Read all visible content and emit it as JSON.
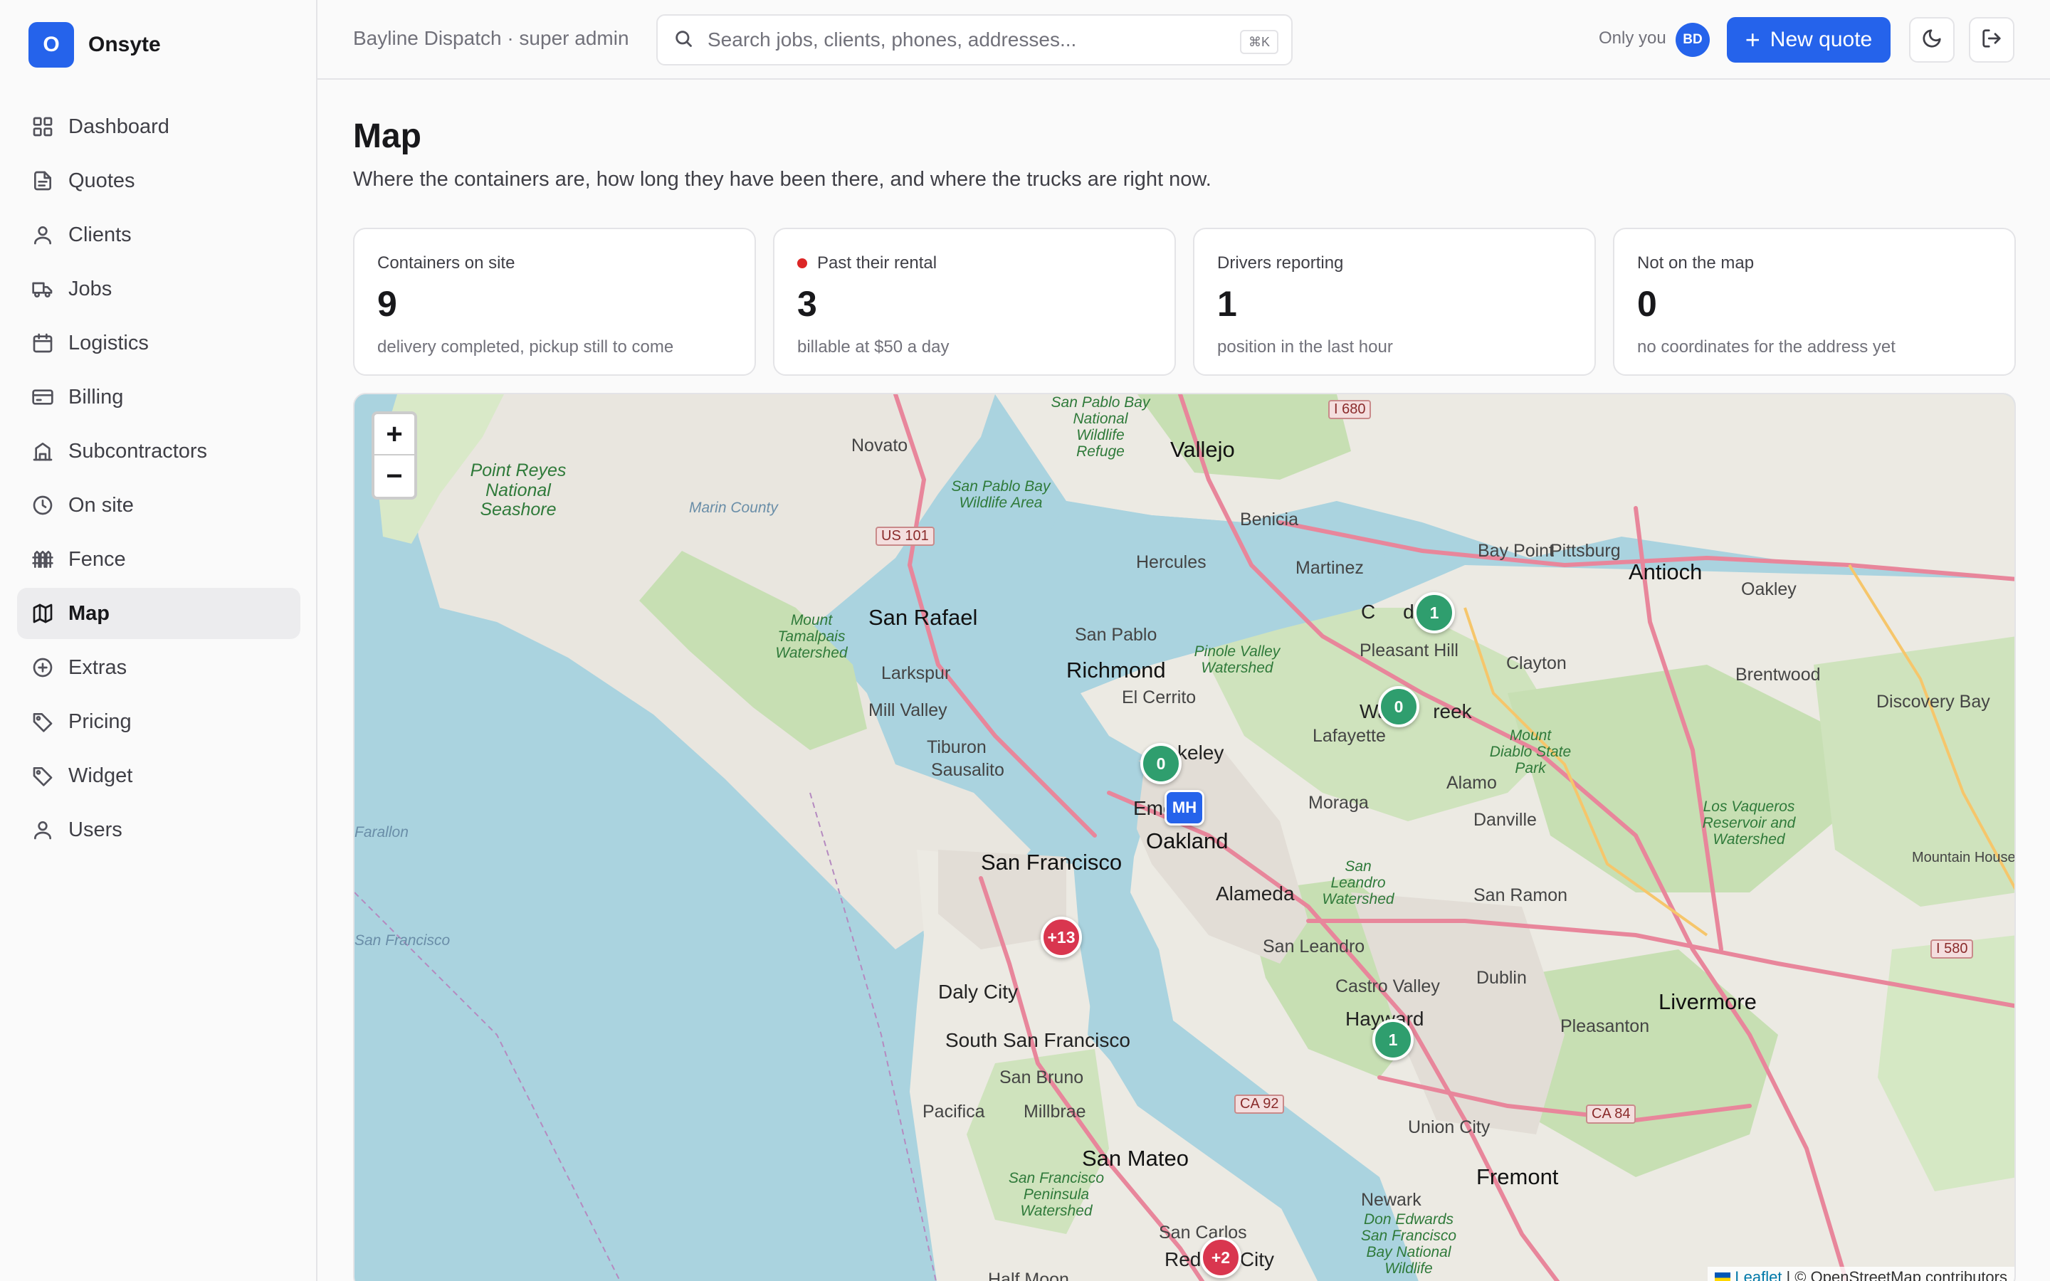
{
  "brand": {
    "logo_letter": "O",
    "name": "Onsyte"
  },
  "nav": {
    "items": [
      {
        "label": "Dashboard",
        "icon": "dashboard-icon"
      },
      {
        "label": "Quotes",
        "icon": "document-icon"
      },
      {
        "label": "Clients",
        "icon": "user-icon"
      },
      {
        "label": "Jobs",
        "icon": "truck-icon"
      },
      {
        "label": "Logistics",
        "icon": "calendar-icon"
      },
      {
        "label": "Billing",
        "icon": "credit-card-icon"
      },
      {
        "label": "Subcontractors",
        "icon": "building-icon"
      },
      {
        "label": "On site",
        "icon": "clock-icon"
      },
      {
        "label": "Fence",
        "icon": "fence-icon"
      },
      {
        "label": "Map",
        "icon": "map-icon",
        "active": true
      },
      {
        "label": "Extras",
        "icon": "plus-circle-icon"
      },
      {
        "label": "Pricing",
        "icon": "tag-icon"
      },
      {
        "label": "Widget",
        "icon": "tag-icon"
      },
      {
        "label": "Users",
        "icon": "user-icon"
      }
    ]
  },
  "header": {
    "org": "Bayline Dispatch · super admin",
    "search_placeholder": "Search jobs, clients, phones, addresses...",
    "search_shortcut": "⌘K",
    "visibility": "Only you",
    "avatar_initials": "BD",
    "new_quote_label": "New quote"
  },
  "page": {
    "title": "Map",
    "subtitle": "Where the containers are, how long they have been there, and where the trucks are right now."
  },
  "stats": [
    {
      "label": "Containers on site",
      "value": "9",
      "note": "delivery completed, pickup still to come",
      "dot": false
    },
    {
      "label": "Past their rental",
      "value": "3",
      "note": "billable at $50 a day",
      "dot": true,
      "dot_color": "#dc2626"
    },
    {
      "label": "Drivers reporting",
      "value": "1",
      "note": "position in the last hour",
      "dot": false
    },
    {
      "label": "Not on the map",
      "value": "0",
      "note": "no coordinates for the address yet",
      "dot": false
    }
  ],
  "map": {
    "zoom_in": "+",
    "zoom_out": "−",
    "markers": [
      {
        "label": "1",
        "color": "green"
      },
      {
        "label": "0",
        "color": "green"
      },
      {
        "label": "0",
        "color": "green"
      },
      {
        "label": "+13",
        "color": "red"
      },
      {
        "label": "1",
        "color": "green"
      },
      {
        "label": "+2",
        "color": "red"
      }
    ],
    "truck": {
      "label": "MH",
      "color": "#2563eb"
    },
    "attribution_leaflet": "Leaflet",
    "attribution_osm": "| © OpenStreetMap contributors",
    "places": {
      "vallejo": "Vallejo",
      "novato": "Novato",
      "benicia": "Benicia",
      "martinez": "Martinez",
      "hercules": "Hercules",
      "bay_point": "Bay Point",
      "pittsburg": "Pittsburg",
      "antioch": "Antioch",
      "oakley": "Oakley",
      "san_rafael": "San Rafael",
      "san_pablo": "San Pablo",
      "richmond": "Richmond",
      "el_cerrito": "El Cerrito",
      "pleasant_hill": "Pleasant Hill",
      "clayton": "Clayton",
      "brentwood": "Brentwood",
      "discovery_bay": "Discovery Bay",
      "larkspur": "Larkspur",
      "mill_valley": "Mill Valley",
      "lafayette": "Lafayette",
      "tiburon": "Tiburon",
      "sausalito": "Sausalito",
      "alamo": "Alamo",
      "moraga": "Moraga",
      "danville": "Danville",
      "oakland": "Oakland",
      "san_francisco": "San Francisco",
      "alameda": "Alameda",
      "san_ramon": "San Ramon",
      "san_leandro": "San Leandro",
      "daly_city": "Daly City",
      "castro_valley": "Castro Valley",
      "dublin": "Dublin",
      "livermore": "Livermore",
      "pleasanton": "Pleasanton",
      "south_sf": "South San Francisco",
      "san_bruno": "San Bruno",
      "pacifica": "Pacifica",
      "millbrae": "Millbrae",
      "union_city": "Union City",
      "san_mateo": "San Mateo",
      "fremont": "Fremont",
      "newark": "Newark",
      "san_carlos": "San Carlos",
      "half_moon": "Half Moon",
      "mountain_house": "Mountain House",
      "marin_county": "Marin County",
      "eme": "Eme",
      "keley": "keley",
      "cord": "C     d",
      "wa_reek": "Wa        reek",
      "hayward": "Hayward",
      "red_city": "Red       City",
      "farallon": "Farallon",
      "san_francisco_county": "San Francisco"
    },
    "parks": {
      "point_reyes": "Point Reyes National Seashore",
      "mt_tam": "Mount Tamalpais Watershed",
      "san_pablo_bay": "San Pablo Bay Wildlife Area",
      "sp_wildlife": "San Pablo Bay National Wildlife Refuge",
      "pinole": "Pinole Valley Watershed",
      "mt_diablo": "Mount Diablo State Park",
      "los_vaqueros": "Los Vaqueros Reservoir and Watershed",
      "san_leandro_ws": "San Leandro Watershed",
      "sf_peninsula": "San Francisco Peninsula Watershed",
      "don_edwards": "Don Edwards San Francisco Bay National Wildlife"
    },
    "shields": {
      "i680": "I 680",
      "us101": "US 101",
      "i580": "I 580",
      "ca92": "CA 92",
      "ca84": "CA 84"
    }
  },
  "colors": {
    "accent": "#2563eb",
    "overdue": "#d9364f",
    "on_site": "#2f9e6e"
  }
}
